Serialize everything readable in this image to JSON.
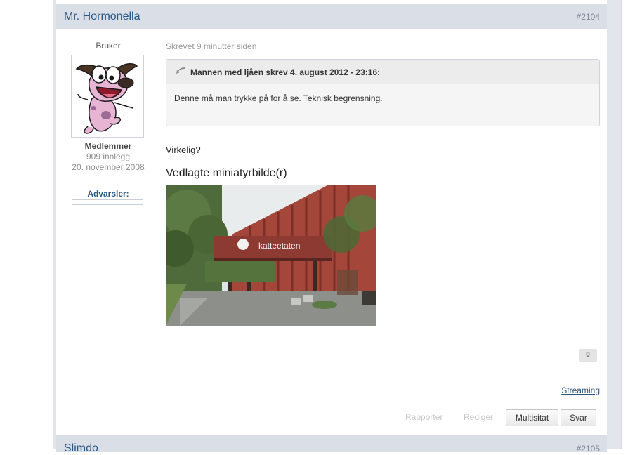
{
  "post": {
    "author": "Mr. Hormonella",
    "number": "#2104",
    "user_title": "Bruker",
    "user_group": "Medlemmer",
    "user_posts": "909 innlegg",
    "user_joined": "20. november 2008",
    "warnings_label": "Advarsler:",
    "posted": "Skrevet 9 minutter siden",
    "quote": {
      "citation": "Mannen med ljåen skrev 4. august 2012 - 23:16:",
      "text": "Denne må man trykke på for å se. Teknisk begrensning."
    },
    "message": "Virkelig?",
    "attachments_title": "Vedlagte miniatyrbilde(r)",
    "attachment_sign_text": "katteetaten",
    "reputation": "0",
    "signature_link": "Streaming",
    "actions": {
      "report": "Rapporter",
      "edit": "Rediger",
      "multiquote": "Multisitat",
      "reply": "Svar"
    }
  },
  "next_post": {
    "author": "Slimdo",
    "number": "#2105"
  }
}
